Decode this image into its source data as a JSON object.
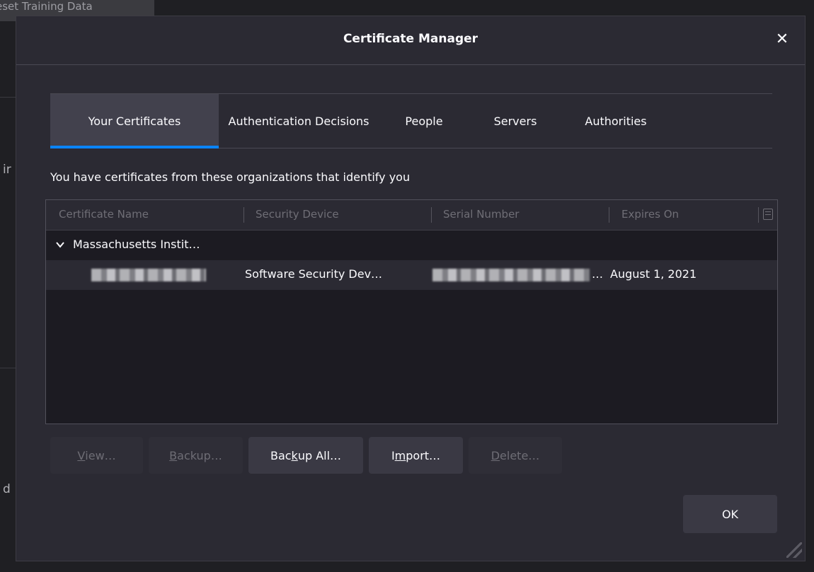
{
  "background": {
    "tab_label": "eset Training Data",
    "frag1": "ir",
    "frag2": "d"
  },
  "dialog": {
    "title": "Certificate Manager",
    "close_label": "✕"
  },
  "tabs": [
    {
      "label": "Your Certificates",
      "active": true
    },
    {
      "label": "Authentication Decisions",
      "active": false
    },
    {
      "label": "People",
      "active": false
    },
    {
      "label": "Servers",
      "active": false
    },
    {
      "label": "Authorities",
      "active": false
    }
  ],
  "description": "You have certificates from these organizations that identify you",
  "table": {
    "columns": [
      "Certificate Name",
      "Security Device",
      "Serial Number",
      "Expires On"
    ],
    "group": "Massachusetts Instit…",
    "rows": [
      {
        "name": "",
        "security_device": "Software Security Dev…",
        "serial_suffix": "…",
        "expires": "August 1, 2021"
      }
    ]
  },
  "buttons": {
    "view": {
      "pre": "",
      "u": "V",
      "post": "iew…",
      "enabled": false
    },
    "backup": {
      "pre": "",
      "u": "B",
      "post": "ackup…",
      "enabled": false
    },
    "backup_all": {
      "pre": "Bac",
      "u": "k",
      "post": "up All…",
      "enabled": true
    },
    "import": {
      "pre": "I",
      "u": "m",
      "post": "port…",
      "enabled": true
    },
    "delete": {
      "pre": "",
      "u": "D",
      "post": "elete…",
      "enabled": false
    },
    "ok": "OK"
  },
  "colors": {
    "accent": "#0a84ff",
    "dialog_bg": "#2b2a33",
    "text": "#fbfbfe"
  }
}
